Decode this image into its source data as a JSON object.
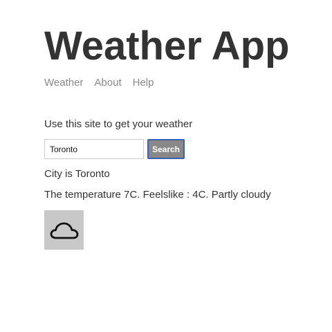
{
  "app": {
    "title": "Weather App"
  },
  "nav": {
    "items": [
      {
        "label": "Weather"
      },
      {
        "label": "About"
      },
      {
        "label": "Help"
      }
    ]
  },
  "main": {
    "intro": "Use this site to get your weather",
    "search": {
      "value": "Toronto",
      "button_label": "Search"
    },
    "city_text": "City is Toronto",
    "forecast_text": "The temperature 7C. Feelslike : 4C. Partly cloudy",
    "weather_icon": "cloud-icon"
  },
  "colors": {
    "title": "#333333",
    "nav_link": "#888888",
    "button_bg": "#888888",
    "button_border": "#3a62b0",
    "icon_bg": "#c8c8c8"
  }
}
